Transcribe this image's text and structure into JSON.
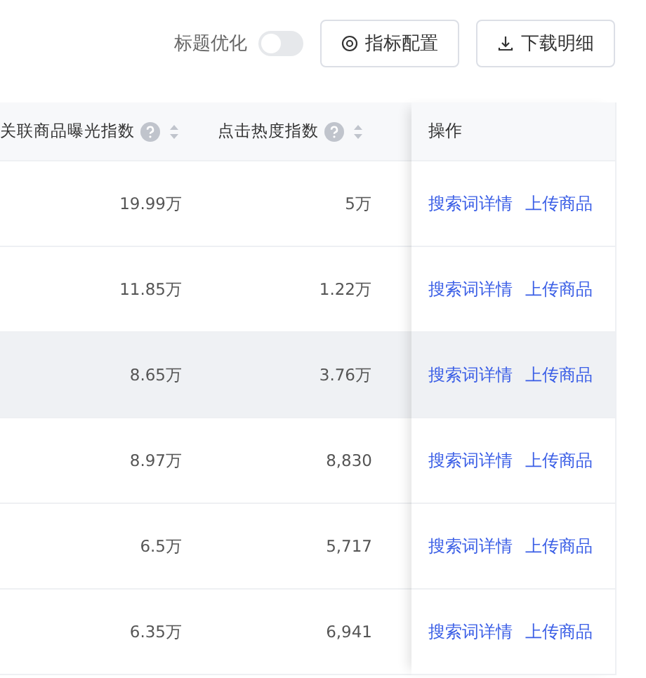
{
  "toolbar": {
    "toggle": {
      "label": "标题优化",
      "on": false
    },
    "buttons": [
      {
        "kind": "settings",
        "label": "指标配置"
      },
      {
        "kind": "download",
        "label": "下载明细"
      }
    ]
  },
  "table": {
    "columns": [
      {
        "label": "关联商品曝光指数"
      },
      {
        "label": "点击热度指数"
      }
    ],
    "action_column": "操作",
    "rows": [
      {
        "values": [
          "19.99万",
          "5万"
        ],
        "actions": [
          "搜索词详情",
          "上传商品"
        ],
        "selected": false
      },
      {
        "values": [
          "11.85万",
          "1.22万"
        ],
        "actions": [
          "搜索词详情",
          "上传商品"
        ],
        "selected": false
      },
      {
        "values": [
          "8.65万",
          "3.76万"
        ],
        "actions": [
          "搜索词详情",
          "上传商品"
        ],
        "selected": true
      },
      {
        "values": [
          "8.97万",
          "8,830"
        ],
        "actions": [
          "搜索词详情",
          "上传商品"
        ],
        "selected": false
      },
      {
        "values": [
          "6.5万",
          "5,717"
        ],
        "actions": [
          "搜索词详情",
          "上传商品"
        ],
        "selected": false
      },
      {
        "values": [
          "6.35万",
          "6,941"
        ],
        "actions": [
          "搜索词详情",
          "上传商品"
        ],
        "selected": false
      }
    ]
  }
}
